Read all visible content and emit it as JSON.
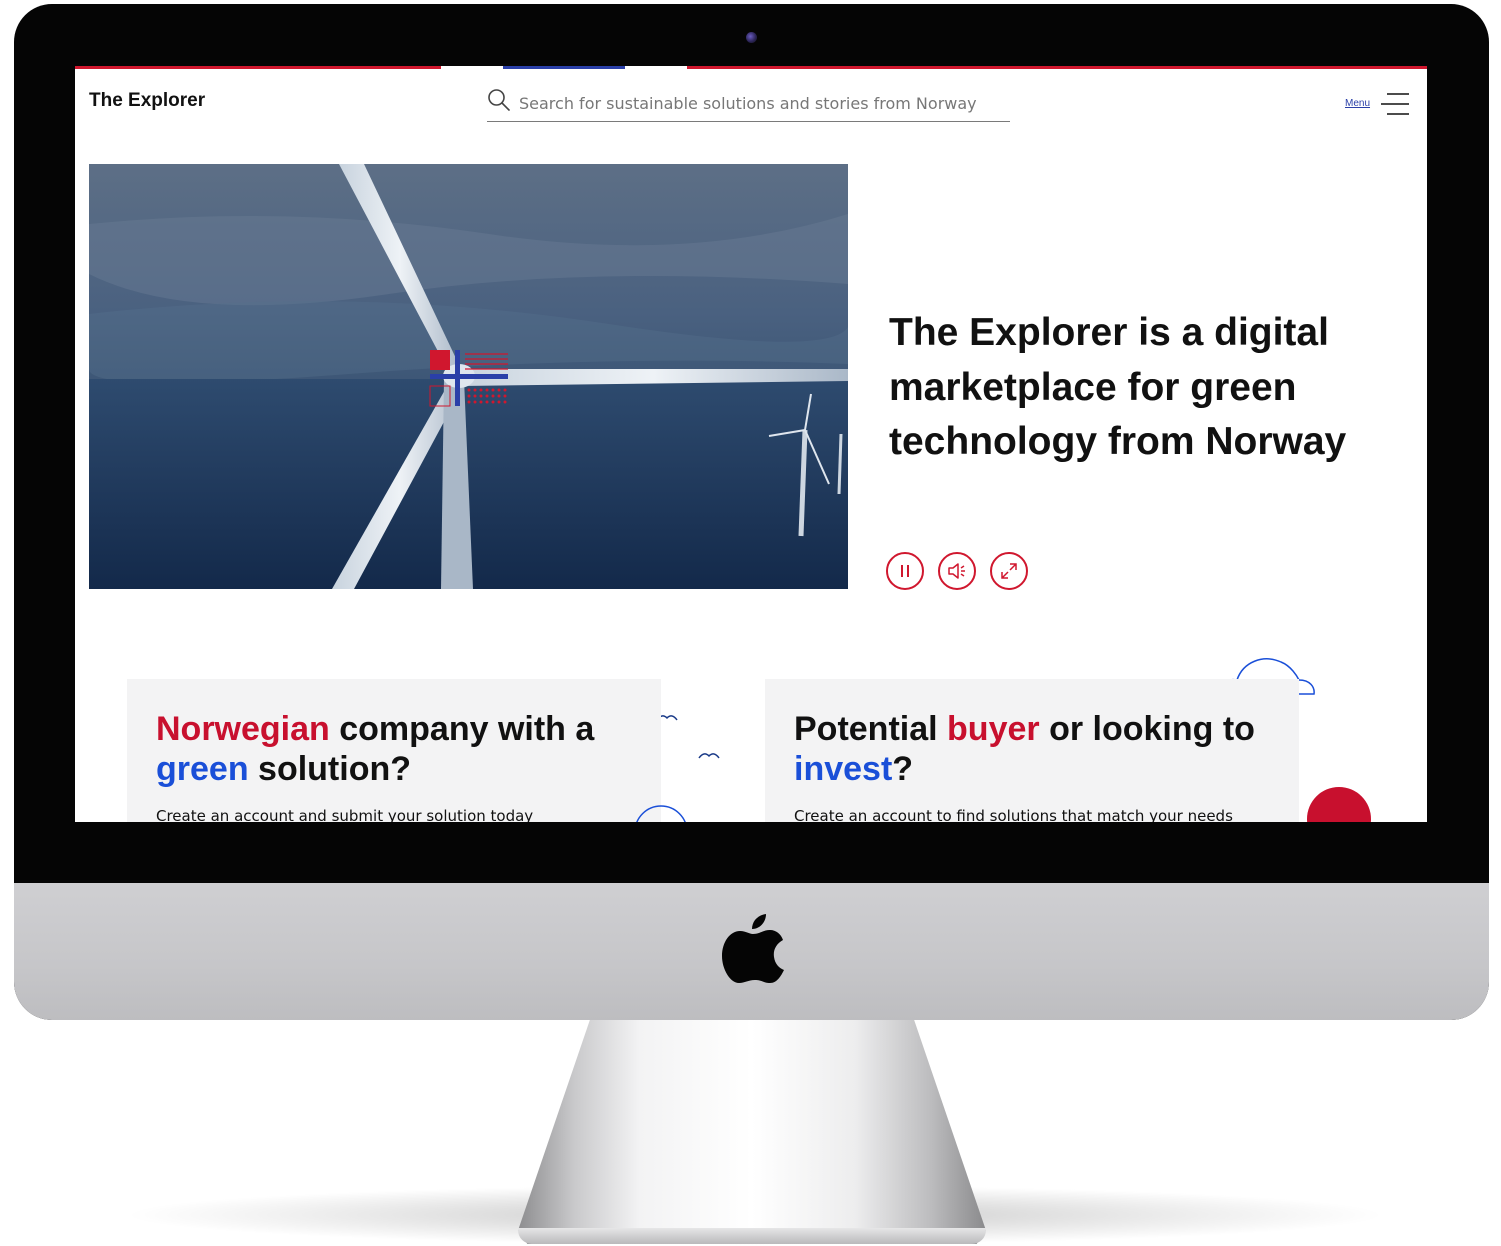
{
  "browser": {
    "brand": "The Explorer",
    "search": {
      "placeholder": "Search for sustainable solutions and stories from Norway"
    },
    "menu_label": "Menu"
  },
  "hero": {
    "title": "The Explorer is a digital marketplace for green technology from Norway",
    "controls": [
      "pause-icon",
      "sound-icon",
      "fullscreen-icon"
    ]
  },
  "cards": [
    {
      "title_parts": [
        "Norwegian",
        " company with a ",
        "green",
        " solution?"
      ],
      "text": "Create an account and submit your solution today"
    },
    {
      "title_parts": [
        "Potential ",
        "buyer",
        " or looking to ",
        "invest",
        "?"
      ],
      "text": "Create an account to find solutions that match your needs"
    }
  ],
  "colors": {
    "accent_red": "#d0172e",
    "accent_blue": "#1a4fd8",
    "card_bg": "#f3f3f4"
  }
}
